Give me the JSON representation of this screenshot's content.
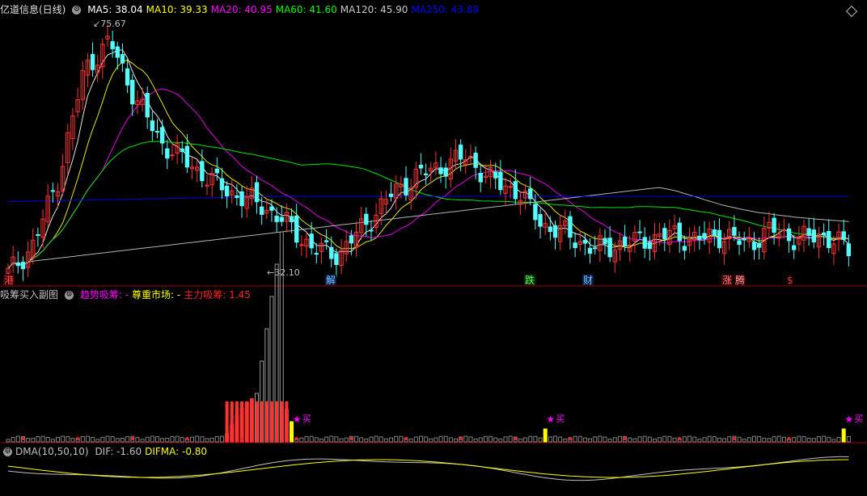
{
  "price_header": {
    "name": "亿道信息(日线)",
    "ma": [
      {
        "label": "MA5: 38.04",
        "color": "#ffffff"
      },
      {
        "label": "MA10: 39.33",
        "color": "#ffff00"
      },
      {
        "label": "MA20: 40.95",
        "color": "#ff00ff"
      },
      {
        "label": "MA60: 41.60",
        "color": "#00ff00"
      },
      {
        "label": "MA120: 45.90",
        "color": "#c8c8c8"
      },
      {
        "label": "MA250: 43.89",
        "color": "#0000ff"
      }
    ]
  },
  "sub_header": {
    "name": "吸筹买入副图",
    "items": [
      {
        "label": "趋势吸筹: -",
        "color": "#ff00ff"
      },
      {
        "label": "尊重市场: -",
        "color": "#ffff00"
      },
      {
        "label": "主力吸筹: 1.45",
        "color": "#ff2020"
      }
    ]
  },
  "dma_header": {
    "name": "DMA(10,50,10)",
    "items": [
      {
        "label": "DIF: -1.60",
        "color": "#c0c0c0"
      },
      {
        "label": "DIFMA: -0.80",
        "color": "#ffff00"
      }
    ]
  },
  "annotations": {
    "high": "75.67",
    "low": "32.10"
  },
  "event_marks": [
    {
      "text": "港",
      "color": "#ff5050",
      "bg": "#3a0000"
    },
    {
      "text": "解",
      "color": "#80c0ff",
      "bg": "#00204a"
    },
    {
      "text": "跌",
      "color": "#60ff60",
      "bg": "#003000"
    },
    {
      "text": "财",
      "color": "#80c0ff",
      "bg": "#00204a"
    },
    {
      "text": "涨",
      "color": "#ff8080",
      "bg": "#3a0000"
    },
    {
      "text": "腾",
      "color": "#ffa0a0",
      "bg": "#3a0000"
    },
    {
      "text": "$",
      "color": "#ff3030",
      "bg": "#000000"
    }
  ],
  "buy_signal": "买",
  "colors": {
    "up": "#ff3232",
    "down": "#54fcfc",
    "axis": "#a00000"
  },
  "chart_data": {
    "type": "candlestick",
    "series_anchor_closes": [
      28,
      34,
      48,
      70,
      75.67,
      64,
      55,
      51,
      47,
      44,
      42,
      38,
      33,
      32.1,
      38,
      44,
      48,
      50,
      52,
      47,
      45,
      38,
      36,
      33,
      34,
      35,
      36,
      35,
      36,
      34,
      37,
      35,
      36,
      33
    ],
    "ma_labels": [
      "MA5",
      "MA10",
      "MA20",
      "MA60",
      "MA120",
      "MA250"
    ],
    "volume_peak_label": "主力吸筹",
    "dma": {
      "dif_last": -1.6,
      "difma_last": -0.8
    }
  }
}
